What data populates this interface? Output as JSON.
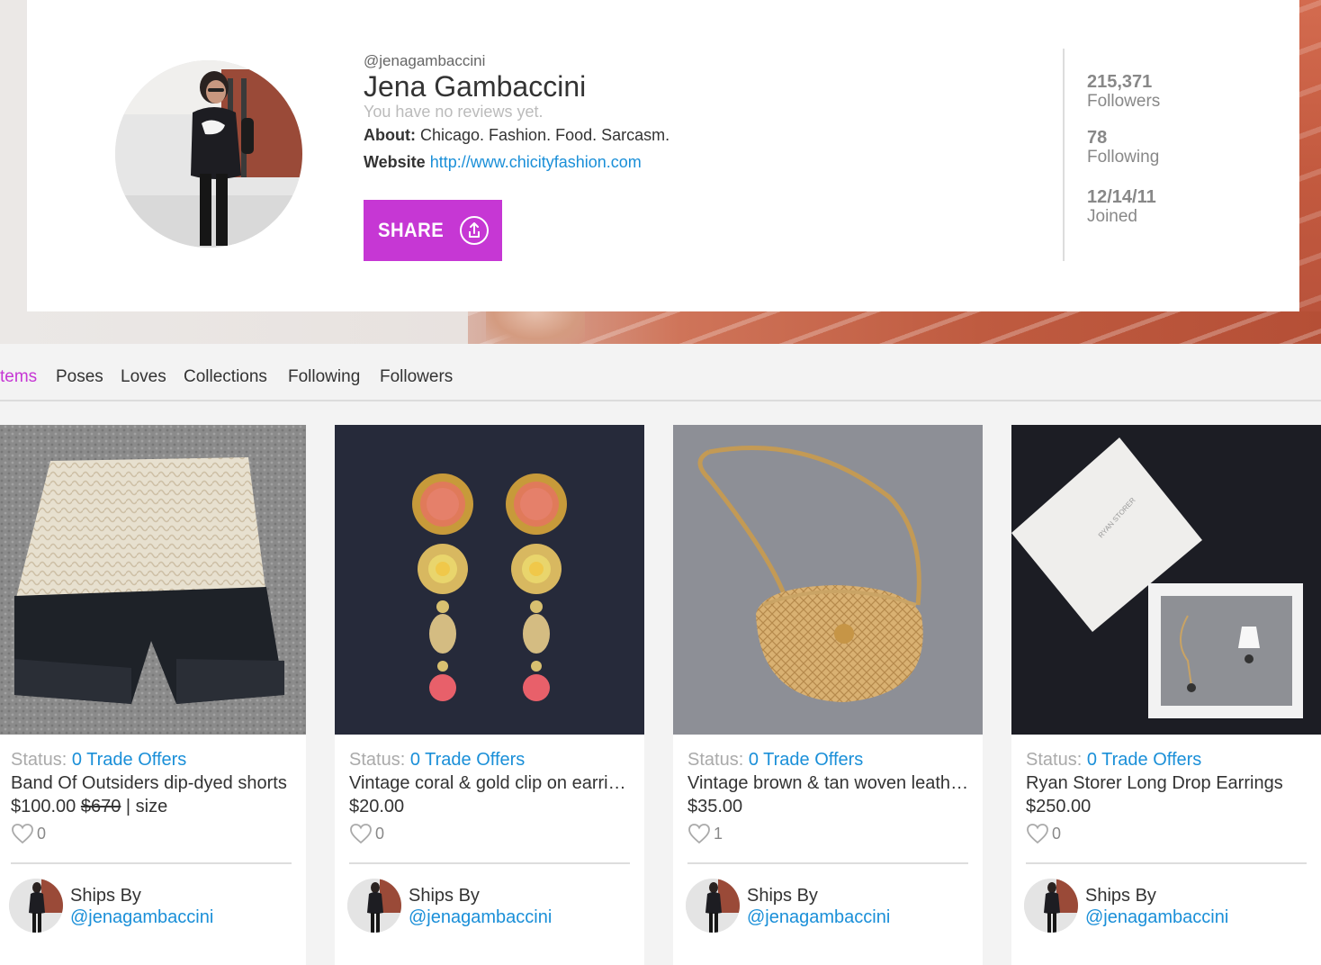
{
  "profile": {
    "handle": "@jenagambaccini",
    "name": "Jena Gambaccini",
    "reviews_text": "You have no reviews yet.",
    "about_label": "About:",
    "about_text": "Chicago. Fashion. Food. Sarcasm.",
    "website_label": "Website",
    "website_url": "http://www.chicityfashion.com",
    "share_label": "SHARE",
    "share_icon": "share-upload-icon"
  },
  "stats": [
    {
      "value": "215,371",
      "label": "Followers"
    },
    {
      "value": "78",
      "label": "Following"
    },
    {
      "value": "12/14/11",
      "label": "Joined"
    }
  ],
  "tabs": [
    {
      "label": "tems",
      "active": true
    },
    {
      "label": "Poses",
      "active": false
    },
    {
      "label": "Loves",
      "active": false
    },
    {
      "label": "Collections",
      "active": false
    },
    {
      "label": "Following",
      "active": false
    },
    {
      "label": "Followers",
      "active": false
    }
  ],
  "items": [
    {
      "status_label": "Status:",
      "status_link": "0 Trade Offers",
      "title": "Band Of Outsiders dip-dyed shorts",
      "price": "$100.00",
      "original_price": "$670",
      "size_text": "| size",
      "likes": "0",
      "ships_label": "Ships By",
      "seller": "@jenagambaccini"
    },
    {
      "status_label": "Status:",
      "status_link": "0 Trade Offers",
      "title": "Vintage coral & gold clip on earrings",
      "price": "$20.00",
      "likes": "0",
      "ships_label": "Ships By",
      "seller": "@jenagambaccini"
    },
    {
      "status_label": "Status:",
      "status_link": "0 Trade Offers",
      "title": "Vintage brown & tan woven leather bag",
      "price": "$35.00",
      "likes": "1",
      "ships_label": "Ships By",
      "seller": "@jenagambaccini"
    },
    {
      "status_label": "Status:",
      "status_link": "0 Trade Offers",
      "title": "Ryan Storer Long Drop Earrings",
      "price": "$250.00",
      "likes": "0",
      "ships_label": "Ships By",
      "seller": "@jenagambaccini"
    }
  ],
  "box_text": "RYAN STORER",
  "colors": {
    "accent": "#c637d4",
    "link": "#1a8fd8",
    "muted": "#aaaaaa"
  }
}
